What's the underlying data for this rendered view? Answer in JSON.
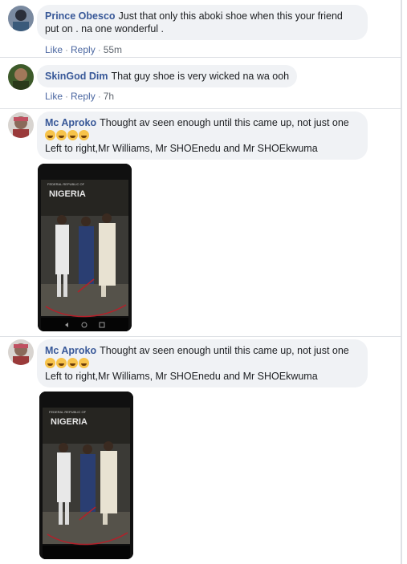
{
  "comments": [
    {
      "name": "Prince Obesco",
      "text_line1": "Just that only this aboki shoe when this your friend",
      "text_line2": "put on . na one wonderful .",
      "like": "Like",
      "reply": "Reply",
      "time": "55m"
    },
    {
      "name": "SkinGod Dim",
      "text_line1": "That guy shoe is very wicked na wa ooh",
      "like": "Like",
      "reply": "Reply",
      "time": "7h"
    },
    {
      "name": "Mc Aproko",
      "text_line1": "Thought av seen enough until this came up, not just one",
      "text_line3": "Left to right,Mr Williams, Mr SHOEnedu and Mr SHOEkwuma",
      "emoji": [
        "laughing-crying-emoji",
        "tired-face-emoji",
        "rolling-laughing-emoji",
        "rolling-laughing-emoji"
      ],
      "photo_text": "NIGERIA",
      "photo_header": "FEDERAL REPUBLIC OF"
    },
    {
      "name": "Mc Aproko",
      "text_line1": "Thought av seen enough until this came up, not just one",
      "text_line3": "Left to right,Mr Williams, Mr SHOEnedu and Mr SHOEkwuma",
      "emoji": [
        "laughing-crying-emoji",
        "tired-face-emoji",
        "rolling-laughing-emoji",
        "rolling-laughing-emoji"
      ],
      "photo_text": "NIGERIA",
      "photo_header": "FEDERAL REPUBLIC OF"
    }
  ],
  "colors": {
    "name": "#385898",
    "bubble": "#f0f2f5",
    "action": "#4b67a1"
  }
}
